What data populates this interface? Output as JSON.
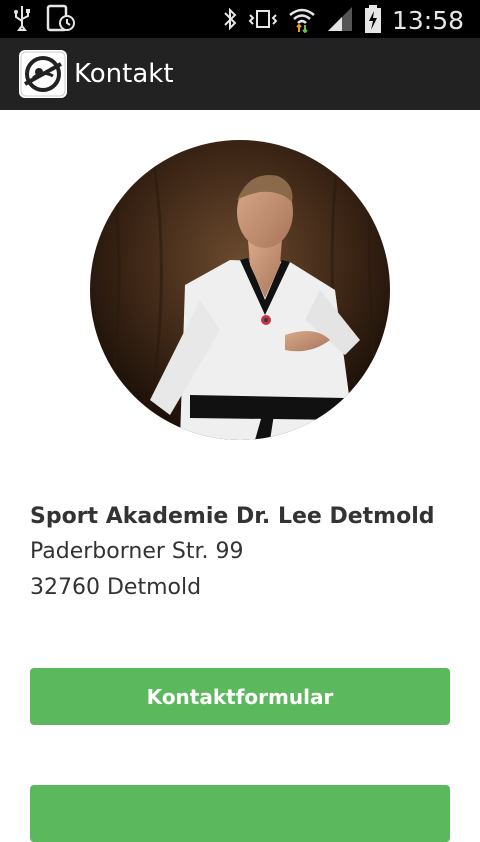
{
  "status_bar": {
    "time": "13:58",
    "icons": [
      "usb-icon",
      "clock-sync-icon",
      "bluetooth-icon",
      "vibrate-icon",
      "wifi-icon",
      "signal-icon",
      "battery-charging-icon"
    ]
  },
  "action_bar": {
    "title": "Kontakt",
    "app_icon": "app-logo-icon"
  },
  "profile": {
    "image": "portrait-photo"
  },
  "address": {
    "name": "Sport Akademie Dr. Lee Detmold",
    "street": "Paderborner Str. 99",
    "city": "32760 Detmold"
  },
  "buttons": {
    "contact_form": "Kontaktformular",
    "second": ""
  },
  "colors": {
    "status_bar_bg": "#000000",
    "action_bar_bg": "#222222",
    "button_green": "#5cb85c",
    "text_dark": "#333333"
  }
}
